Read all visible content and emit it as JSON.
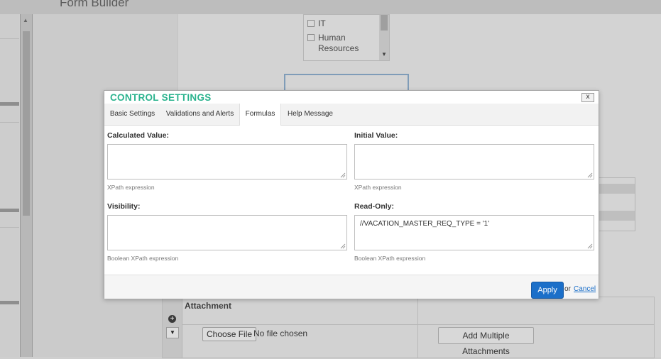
{
  "app": {
    "title": "Form Builder"
  },
  "departments": {
    "items": [
      "IT",
      "Human Resources"
    ]
  },
  "bottom_table": {
    "attachment_label": "Attachment",
    "choose_file_label": "Choose File",
    "no_file_text": "No file chosen",
    "add_multiple_label": "Add Multiple Attachments"
  },
  "modal": {
    "title": "CONTROL SETTINGS",
    "close_label": "x",
    "tabs": [
      {
        "label": "Basic Settings",
        "active": false
      },
      {
        "label": "Validations and Alerts",
        "active": false
      },
      {
        "label": "Formulas",
        "active": true
      },
      {
        "label": "Help Message",
        "active": false
      }
    ],
    "fields": {
      "calculated_value": {
        "label": "Calculated Value:",
        "value": "",
        "hint": "XPath expression"
      },
      "initial_value": {
        "label": "Initial Value:",
        "value": "",
        "hint": "XPath expression"
      },
      "visibility": {
        "label": "Visibility:",
        "value": "",
        "hint": "Boolean XPath expression"
      },
      "read_only": {
        "label": "Read-Only:",
        "value": "//VACATION_MASTER_REQ_TYPE = '1'",
        "hint": "Boolean XPath expression"
      }
    },
    "footer": {
      "apply_label": "Apply",
      "or_text": "or",
      "cancel_label": "Cancel"
    }
  },
  "colors": {
    "title_accent": "#2bb38e",
    "primary_button": "#1b6fc9",
    "overlay": "#cfcfcf"
  }
}
